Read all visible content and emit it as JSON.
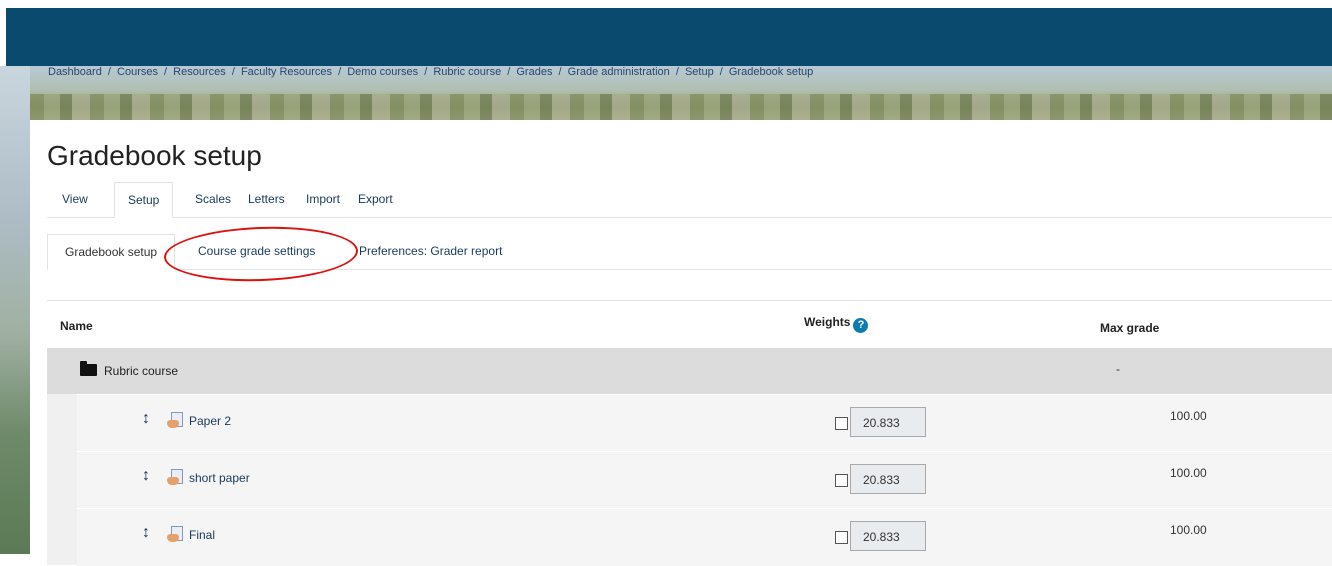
{
  "breadcrumb": [
    "Dashboard",
    "/",
    "Courses",
    "/",
    "Resources",
    "/",
    "Faculty Resources",
    "/",
    "Demo courses",
    "/",
    "Rubric course",
    "/",
    "Grades",
    "/",
    "Grade administration",
    "/",
    "Setup",
    "/",
    "Gradebook setup"
  ],
  "page_title": "Gradebook setup",
  "tabs": [
    "View",
    "Setup",
    "Scales",
    "Letters",
    "Import",
    "Export"
  ],
  "active_tab": "Setup",
  "subtabs": [
    "Gradebook setup",
    "Course grade settings",
    "Preferences: Grader report"
  ],
  "table": {
    "headers": {
      "name": "Name",
      "weights": "Weights",
      "max_grade": "Max grade"
    },
    "category": {
      "name": "Rubric course",
      "max_grade": "-"
    },
    "items": [
      {
        "name": "Paper 2",
        "weight": "20.833",
        "max_grade": "100.00"
      },
      {
        "name": "short paper",
        "weight": "20.833",
        "max_grade": "100.00"
      },
      {
        "name": "Final",
        "weight": "20.833",
        "max_grade": "100.00"
      }
    ]
  },
  "icons": {
    "help": "question-circle-icon",
    "folder": "folder-icon",
    "move": "move-arrows-icon",
    "assignment": "assignment-icon"
  },
  "colors": {
    "header": "#0b4a6f",
    "highlight": "#d11111",
    "link": "#1a3a5a"
  }
}
